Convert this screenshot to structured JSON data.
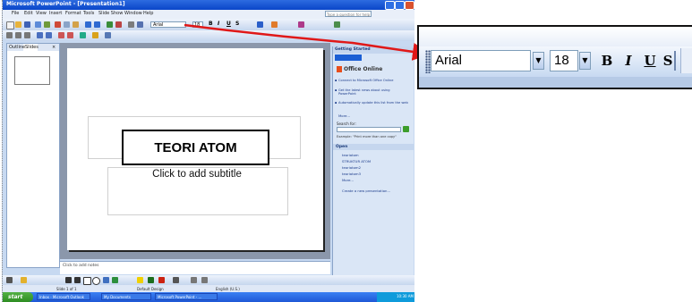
{
  "ppt": {
    "title_bar": "Microsoft PowerPoint - [Presentation1]",
    "menu": [
      "File",
      "Edit",
      "View",
      "Insert",
      "Format",
      "Tools",
      "Slide Show",
      "Window",
      "Help"
    ],
    "help_box": "Type a question for help",
    "font_value": "Arial",
    "size_value": "18",
    "panel_tabs": [
      "Outline",
      "Slides"
    ],
    "slide_title": "TEORI ATOM",
    "slide_subtitle": "Click to add subtitle",
    "notes_placeholder": "Click to add notes",
    "task_pane": {
      "header": "Getting Started",
      "office_online": "Office Online",
      "links": [
        "Connect to Microsoft Office Online",
        "Get the latest news about using PowerPoint",
        "Automatically update this list from the web"
      ],
      "more": "More...",
      "search_label": "Search for:",
      "example": "Example: \"Print more than one copy\"",
      "open_header": "Open",
      "open_files": [
        "teoriatom",
        "STRUKTUR ATOM",
        "teoriatom2",
        "teoriatom3"
      ],
      "open_more": "More...",
      "new_presentation": "Create a new presentation..."
    },
    "status": [
      "Slide 1 of 1",
      "Default Design",
      "English (U.S.)"
    ],
    "taskbar": {
      "start": "start",
      "buttons": [
        "Inbox - Microsoft Outlook",
        "My Documents",
        "Microsoft PowerPoint - ..."
      ],
      "clock": "10:30 AM"
    }
  },
  "zoom": {
    "font": "Arial",
    "size": "18",
    "bold": "B",
    "italic": "I",
    "underline": "U",
    "shadow": "S"
  },
  "colors": {
    "arrow": "#e01818",
    "xp_blue": "#0a46c9"
  }
}
